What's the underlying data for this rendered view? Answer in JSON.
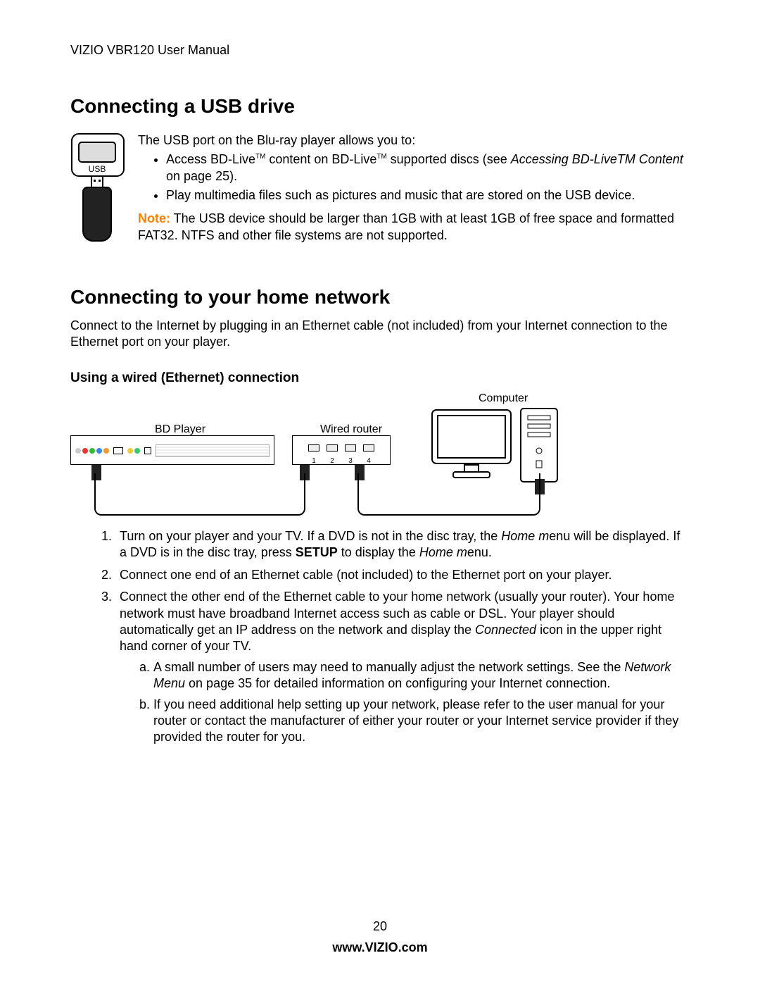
{
  "header": {
    "title": "VIZIO VBR120 User Manual"
  },
  "section_usb": {
    "heading": "Connecting a USB drive",
    "port_label": "USB",
    "intro": "The USB port on the Blu-ray player allows you to:",
    "bullet1_a": "Access BD-Live",
    "bullet1_b": " content on BD-Live",
    "bullet1_c": " supported discs (see ",
    "bullet1_ref": "Accessing BD-LiveTM Content",
    "bullet1_d": " on page 25).",
    "bullet2": "Play multimedia files such as pictures and music that are stored on the USB device.",
    "note_label": "Note:",
    "note_text": " The USB device should be larger than 1GB with at least 1GB of free space and formatted FAT32. NTFS and other file systems are not supported."
  },
  "section_net": {
    "heading": "Connecting to your home network",
    "intro": "Connect to the Internet by plugging in an Ethernet cable (not included) from your Internet connection to the Ethernet port on your player.",
    "subheading": "Using a wired (Ethernet) connection",
    "diagram": {
      "bd_player": "BD Player",
      "router": "Wired router",
      "computer": "Computer"
    },
    "step1_a": "Turn on your player and your TV. If a DVD is not in the disc tray, the ",
    "step1_ref1": "Home m",
    "step1_b": "enu will be displayed. If a DVD is in the disc tray, press ",
    "step1_setup": "SETUP",
    "step1_c": " to display the ",
    "step1_ref2": "Home m",
    "step1_d": "enu.",
    "step2": "Connect one end of an Ethernet cable (not included) to the Ethernet port on your player.",
    "step3_a": "Connect the other end of the Ethernet cable to your home network (usually your router). Your home network must have broadband Internet access such as cable or DSL. Your player should automatically get an IP address on the network and display the ",
    "step3_ref": "Connected",
    "step3_b": " icon in the upper right hand corner of your TV.",
    "sub_a_a": "A small number of users may need to manually adjust the network settings. See the ",
    "sub_a_ref": "Network Menu",
    "sub_a_b": " on page 35 for detailed information on configuring your Internet connection.",
    "sub_b": "If you need additional help setting up your network, please refer to the user manual for your router or contact the manufacturer of either your router or your Internet service provider if they provided the router for you."
  },
  "footer": {
    "page": "20",
    "url": "www.VIZIO.com"
  }
}
